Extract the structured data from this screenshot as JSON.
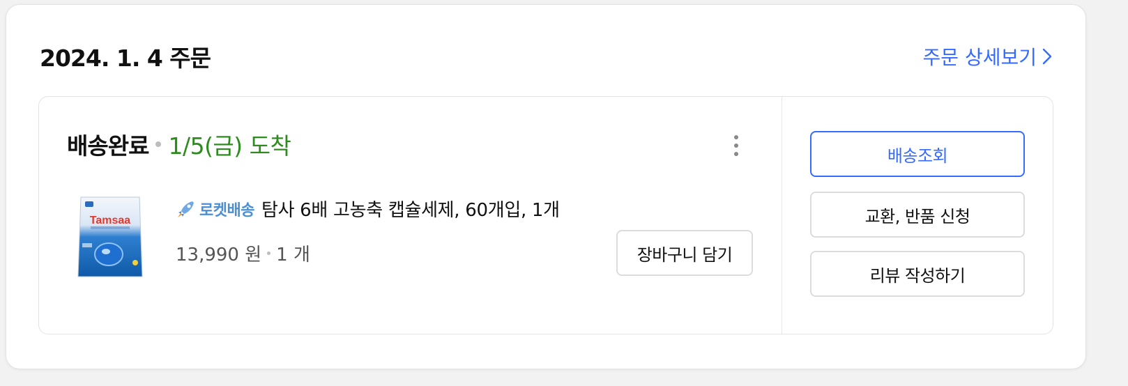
{
  "order": {
    "date_label": "2024. 1. 4 주문",
    "detail_link_label": "주문 상세보기"
  },
  "delivery": {
    "status": "배송완료",
    "arrival": "1/5(금) 도착"
  },
  "product": {
    "badge_label": "로켓배송",
    "name": "탐사 6배 고농축 캡슐세제, 60개입, 1개",
    "price": "13,990 원",
    "quantity": "1 개",
    "image_brand_text": "Tamsaa"
  },
  "buttons": {
    "add_to_cart": "장바구니 담기",
    "track_delivery": "배송조회",
    "exchange_return": "교환, 반품 신청",
    "write_review": "리뷰 작성하기"
  },
  "icons": {
    "more": "more-vertical-icon",
    "chevron": "chevron-right-icon",
    "rocket": "rocket-icon"
  },
  "colors": {
    "accent": "#346aff",
    "arrival_green": "#2e8b1e",
    "rocket_blue": "#4a8fd4"
  }
}
